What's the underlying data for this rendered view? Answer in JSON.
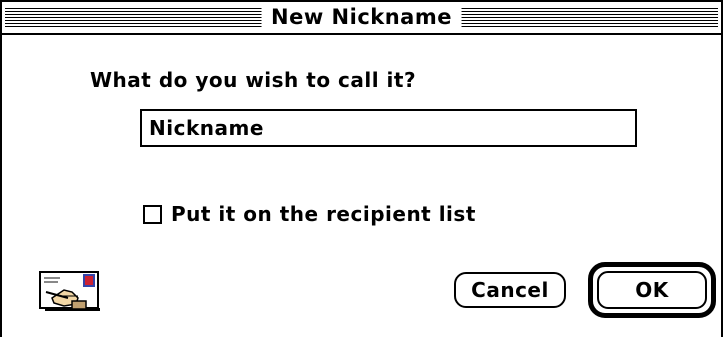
{
  "dialog": {
    "title": "New Nickname",
    "prompt": "What do you wish to call it?",
    "name_field": {
      "value": "Nickname",
      "placeholder": ""
    },
    "recipient_checkbox": {
      "label": "Put it on the recipient list",
      "checked": false
    },
    "app_icon": "envelope-pen-icon",
    "buttons": {
      "cancel_label": "Cancel",
      "ok_label": "OK",
      "default": "ok"
    }
  }
}
